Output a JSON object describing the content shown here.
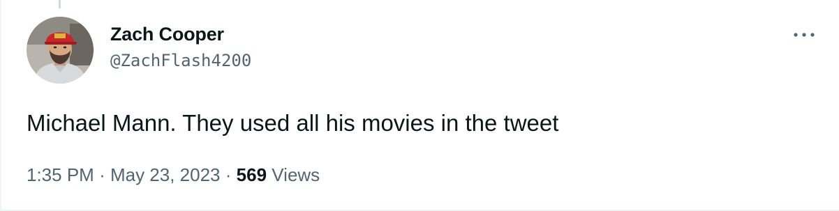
{
  "tweet": {
    "author": {
      "display_name": "Zach Cooper",
      "handle": "@ZachFlash4200"
    },
    "text": "Michael Mann. They used all his movies in the tweet",
    "time": "1:35 PM",
    "separator": "·",
    "date": "May 23, 2023",
    "views_count": "569",
    "views_label": "Views"
  },
  "icons": {
    "more": "more-dots-icon",
    "avatar": "avatar"
  },
  "colors": {
    "primary_text": "#0f1419",
    "secondary_text": "#536471",
    "divider": "#eff3f4",
    "thread_line": "#cfd9de"
  }
}
